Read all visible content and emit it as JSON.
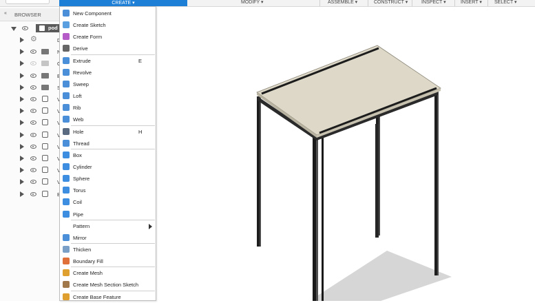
{
  "toolbar": {
    "create_label": "CREATE ▾",
    "modify_label": "MODIFY ▾",
    "assemble_label": "ASSEMBLE ▾",
    "construct_label": "CONSTRUCT ▾",
    "inspect_label": "INSPECT ▾",
    "insert_label": "INSERT ▾",
    "select_label": "SELECT ▾"
  },
  "browser": {
    "collapse_icon": "«",
    "title": "BROWSER",
    "root_label": "pod",
    "items": [
      {
        "label": "Docum",
        "icon": "gear-icon"
      },
      {
        "label": "Named",
        "icon": "folder-icon"
      },
      {
        "label": "O",
        "icon": "folder-icon"
      },
      {
        "label": "B",
        "icon": "folder-icon"
      },
      {
        "label": "S",
        "icon": "folder-icon"
      },
      {
        "label": "V",
        "icon": "body-icon"
      },
      {
        "label": "V",
        "icon": "body-icon"
      },
      {
        "label": "V",
        "icon": "body-icon"
      },
      {
        "label": "V",
        "icon": "body-icon"
      },
      {
        "label": "V",
        "icon": "body-icon"
      },
      {
        "label": "V",
        "icon": "body-icon"
      },
      {
        "label": "V",
        "icon": "body-icon"
      },
      {
        "label": "V",
        "icon": "body-icon"
      },
      {
        "label": "B",
        "icon": "body-icon"
      }
    ]
  },
  "create_menu": {
    "items": [
      {
        "label": "New Component",
        "shortcut": "",
        "icon": "new-component-icon",
        "color": "#4a8fd8"
      },
      {
        "label": "Create Sketch",
        "shortcut": "",
        "icon": "create-sketch-icon",
        "color": "#5aa0e0"
      },
      {
        "label": "Create Form",
        "shortcut": "",
        "icon": "create-form-icon",
        "color": "#b55cc8"
      },
      {
        "label": "Derive",
        "shortcut": "",
        "icon": "derive-icon",
        "color": "#666666"
      },
      {
        "label": "Extrude",
        "shortcut": "E",
        "icon": "extrude-icon",
        "color": "#4a8fd8"
      },
      {
        "label": "Revolve",
        "shortcut": "",
        "icon": "revolve-icon",
        "color": "#4a8fd8"
      },
      {
        "label": "Sweep",
        "shortcut": "",
        "icon": "sweep-icon",
        "color": "#4a8fd8"
      },
      {
        "label": "Loft",
        "shortcut": "",
        "icon": "loft-icon",
        "color": "#4a8fd8"
      },
      {
        "label": "Rib",
        "shortcut": "",
        "icon": "rib-icon",
        "color": "#4a8fd8"
      },
      {
        "label": "Web",
        "shortcut": "",
        "icon": "web-icon",
        "color": "#4a8fd8"
      },
      {
        "label": "Hole",
        "shortcut": "H",
        "icon": "hole-icon",
        "color": "#5a6a80"
      },
      {
        "label": "Thread",
        "shortcut": "",
        "icon": "thread-icon",
        "color": "#4a8fd8"
      },
      {
        "label": "Box",
        "shortcut": "",
        "icon": "box-icon",
        "color": "#3d8ee0"
      },
      {
        "label": "Cylinder",
        "shortcut": "",
        "icon": "cylinder-icon",
        "color": "#3d8ee0"
      },
      {
        "label": "Sphere",
        "shortcut": "",
        "icon": "sphere-icon",
        "color": "#3d8ee0"
      },
      {
        "label": "Torus",
        "shortcut": "",
        "icon": "torus-icon",
        "color": "#3d8ee0"
      },
      {
        "label": "Coil",
        "shortcut": "",
        "icon": "coil-icon",
        "color": "#3d8ee0"
      },
      {
        "label": "Pipe",
        "shortcut": "",
        "icon": "pipe-icon",
        "color": "#3d8ee0"
      },
      {
        "label": "Pattern",
        "shortcut": "",
        "icon": "",
        "color": "#ffffff",
        "submenu": true
      },
      {
        "label": "Mirror",
        "shortcut": "",
        "icon": "mirror-icon",
        "color": "#4a8fd8"
      },
      {
        "label": "Thicken",
        "shortcut": "",
        "icon": "thicken-icon",
        "color": "#7aa0c8"
      },
      {
        "label": "Boundary Fill",
        "shortcut": "",
        "icon": "boundary-fill-icon",
        "color": "#e0703a"
      },
      {
        "label": "Create Mesh",
        "shortcut": "",
        "icon": "create-mesh-icon",
        "color": "#e0a030"
      },
      {
        "label": "Create Mesh Section Sketch",
        "shortcut": "",
        "icon": "mesh-section-sketch-icon",
        "color": "#a0784a"
      },
      {
        "label": "Create Base Feature",
        "shortcut": "",
        "icon": "base-feature-icon",
        "color": "#e0a030"
      }
    ]
  },
  "colors": {
    "accent": "#1e7fd6",
    "table_top": "#ddd8c8",
    "frame": "#2a2a2a"
  }
}
